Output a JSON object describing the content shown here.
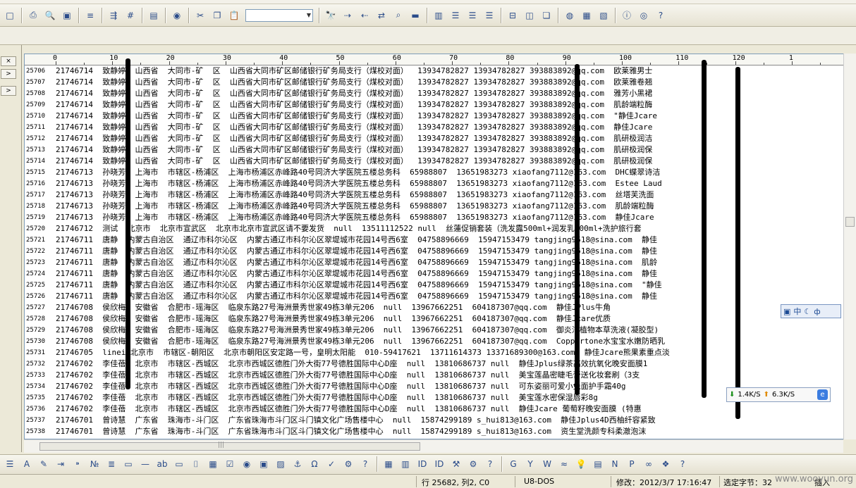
{
  "toolbar": {
    "combo_value": "",
    "help_label": "?"
  },
  "bottom_toolbar": {
    "help_label": "?",
    "help_label2": "?"
  },
  "ruler": {
    "marks": [
      "0",
      "10",
      "20",
      "30",
      "40",
      "50",
      "60",
      "70",
      "80",
      "90",
      "100",
      "110",
      "120",
      "1"
    ]
  },
  "left_panel": {
    "btn1": "×",
    "btn2": ">",
    "btn3": ">"
  },
  "editor": {
    "lines": [
      {
        "num": "25706",
        "text": "21746714  致静婷  山西省  大同市-矿  区  山西省大同市矿区邮储银行矿务局支行（煤校对面）  13934782827 13934782827 393883892@qq.com  欧莱雅男士"
      },
      {
        "num": "25707",
        "text": "21746714  致静婷  山西省  大同市-矿  区  山西省大同市矿区邮储银行矿务局支行（煤校对面）  13934782827 13934782827 393883892@qq.com  欧莱雅卷翘"
      },
      {
        "num": "25708",
        "text": "21746714  致静婷  山西省  大同市-矿  区  山西省大同市矿区邮储银行矿务局支行（煤校对面）  13934782827 13934782827 393883892@qq.com  雅芳小黑裙"
      },
      {
        "num": "25709",
        "text": "21746714  致静婷  山西省  大同市-矿  区  山西省大同市矿区邮储银行矿务局支行（煤校对面）  13934782827 13934782827 393883892@qq.com  肌龄端粒酶"
      },
      {
        "num": "25710",
        "text": "21746714  致静婷  山西省  大同市-矿  区  山西省大同市矿区邮储银行矿务局支行（煤校对面）  13934782827 13934782827 393883892@qq.com  \"静佳Jcare"
      },
      {
        "num": "25711",
        "text": "21746714  致静婷  山西省  大同市-矿  区  山西省大同市矿区邮储银行矿务局支行（煤校对面）  13934782827 13934782827 393883892@qq.com  静佳Jcare"
      },
      {
        "num": "25712",
        "text": "21746714  致静婷  山西省  大同市-矿  区  山西省大同市矿区邮储银行矿务局支行（煤校对面）  13934782827 13934782827 393883892@qq.com  肌研极润洁"
      },
      {
        "num": "25713",
        "text": "21746714  致静婷  山西省  大同市-矿  区  山西省大同市矿区邮储银行矿务局支行（煤校对面）  13934782827 13934782827 393883892@qq.com  肌研极润保"
      },
      {
        "num": "25714",
        "text": "21746714  致静婷  山西省  大同市-矿  区  山西省大同市矿区邮储银行矿务局支行（煤校对面）  13934782827 13934782827 393883892@qq.com  肌研极润保"
      },
      {
        "num": "25715",
        "text": "21746713  孙晓芳  上海市  市辖区-杨浦区  上海市杨浦区赤峰路40号同济大学医院五楼总务科  65988807  13651983273 xiaofang7112@163.com  DHC蝶翠诗洁"
      },
      {
        "num": "25716",
        "text": "21746713  孙晓芳  上海市  市辖区-杨浦区  上海市杨浦区赤峰路40号同济大学医院五楼总务科  65988807  13651983273 xiaofang7112@163.com  Estee Laud"
      },
      {
        "num": "25717",
        "text": "21746713  孙晓芳  上海市  市辖区-杨浦区  上海市杨浦区赤峰路40号同济大学医院五楼总务科  65988807  13651983273 xiaofang7112@163.com  丝塔芙洗面"
      },
      {
        "num": "25718",
        "text": "21746713  孙晓芳  上海市  市辖区-杨浦区  上海市杨浦区赤峰路40号同济大学医院五楼总务科  65988807  13651983273 xiaofang7112@163.com  肌龄端粒酶"
      },
      {
        "num": "25719",
        "text": "21746713  孙晓芳  上海市  市辖区-杨浦区  上海市杨浦区赤峰路40号同济大学医院五楼总务科  65988807  13651983273 xiaofang7112@163.com  静佳Jcare"
      },
      {
        "num": "25720",
        "text": "21746712  测试  北京市  北京市宣武区  北京市北京市宣武区请不要发货  null  13511112522 null  丝蓮促销套装（洗发露500ml+润发乳500ml+洗护旅行套"
      },
      {
        "num": "25721",
        "text": "21746711  唐静  内蒙古自治区  通辽市科尔沁区  内蒙古通辽市科尔沁区翠堤城市花园14号西6室  04758896669  15947153479 tangjing9518@sina.com  静佳"
      },
      {
        "num": "25722",
        "text": "21746711  唐静  内蒙古自治区  通辽市科尔沁区  内蒙古通辽市科尔沁区翠堤城市花园14号西6室  04758896669  15947153479 tangjing9518@sina.com  静佳"
      },
      {
        "num": "25723",
        "text": "21746711  唐静  内蒙古自治区  通辽市科尔沁区  内蒙古通辽市科尔沁区翠堤城市花园14号西6室  04758896669  15947153479 tangjing9518@sina.com  肌龄"
      },
      {
        "num": "25724",
        "text": "21746711  唐静  内蒙古自治区  通辽市科尔沁区  内蒙古通辽市科尔沁区翠堤城市花园14号西6室  04758896669  15947153479 tangjing9518@sina.com  静佳"
      },
      {
        "num": "25725",
        "text": "21746711  唐静  内蒙古自治区  通辽市科尔沁区  内蒙古通辽市科尔沁区翠堤城市花园14号西6室  04758896669  15947153479 tangjing9518@sina.com  \"静佳"
      },
      {
        "num": "25726",
        "text": "21746711  唐静  内蒙古自治区  通辽市科尔沁区  内蒙古通辽市科尔沁区翠堤城市花园14号西6室  04758896669  15947153479 tangjing9518@sina.com  静佳"
      },
      {
        "num": "25727",
        "text": "21746708  侯欣梅  安徽省  合肥市-瑶海区  临泉东路27号海洲景秀世家49栋3单元206  null  13967662251  604187307@qq.com  静佳JPlus牛角"
      },
      {
        "num": "25728",
        "text": "21746708  侯欣梅  安徽省  合肥市-瑶海区  临泉东路27号海洲景秀世家49栋3单元206  null  13967662251  604187307@qq.com  静佳Jcare优质"
      },
      {
        "num": "25729",
        "text": "21746708  侯欣梅  安徽省  合肥市-瑶海区  临泉东路27号海洲景秀世家49栋3单元206  null  13967662251  604187307@qq.com  御炎洁植物本草洗液(凝胶型)"
      },
      {
        "num": "25730",
        "text": "21746708  侯欣梅  安徽省  合肥市-瑶海区  临泉东路27号海洲景秀世家49栋3单元206  null  13967662251  604187307@qq.com  Coppertone水宝宝水嫩防晒乳"
      },
      {
        "num": "25731",
        "text": "21746705  linei 北京市  市辖区-朝阳区  北京市朝阳区安定路一号，皇明太阳能  010-59417621  13711614373 13371689300@163.com  静佳Jcare熊果素重点淡"
      },
      {
        "num": "25732",
        "text": "21746702  李佳蓓  北京市  市辖区-西城区  北京市西城区德胜门外大街77号德胜国际中心D座  null  13810686737 null  静佳Jplus绿茶高效抗氧化晚安面膜1"
      },
      {
        "num": "25733",
        "text": "21746702  李佳蓓  北京市  市辖区-西城区  北京市西城区德胜门外大街77号德胜国际中心D座  null  13810686737 null  美宝莲晶密睫毛膏送化妆套刷（3支"
      },
      {
        "num": "25734",
        "text": "21746702  李佳蓓  北京市  市辖区-西城区  北京市西城区德胜门外大街77号德胜国际中心D座  null  13810686737 null  可东姿丽可爱小兔面护手霜40g"
      },
      {
        "num": "25735",
        "text": "21746702  李佳蓓  北京市  市辖区-西城区  北京市西城区德胜门外大街77号德胜国际中心D座  null  13810686737 null  美宝莲水密保湿唇彩8g"
      },
      {
        "num": "25736",
        "text": "21746702  李佳蓓  北京市  市辖区-西城区  北京市西城区德胜门外大街77号德胜国际中心D座  null  13810686737 null  静佳Jcare 葡萄籽晚安面膜 (特惠"
      },
      {
        "num": "25737",
        "text": "21746701  曾诗慧  广东省  珠海市-斗门区  广东省珠海市斗门区斗门镇文化广场售楼中心  null  15874299189 s_hui813@163.com  静佳Jplus4D西柚纤容紧致"
      },
      {
        "num": "25738",
        "text": "21746701  曾诗慧  广东省  珠海市-斗门区  广东省珠海市斗门区斗门镇文化广场售楼中心  null  15874299189 s_hui813@163.com  资生堂洗颜专科柔澈泡沫"
      }
    ]
  },
  "ime": {
    "label": "中"
  },
  "netspeed": {
    "down": "1.4K/S",
    "up": "6.3K/S"
  },
  "status": {
    "position": "行 25682, 列2, C0",
    "encoding": "U8-DOS",
    "modified": "修改：2012/3/7 17:16:47",
    "selected": "选定字节：32",
    "insert": "插入"
  },
  "watermark": "www.wooyun.org"
}
